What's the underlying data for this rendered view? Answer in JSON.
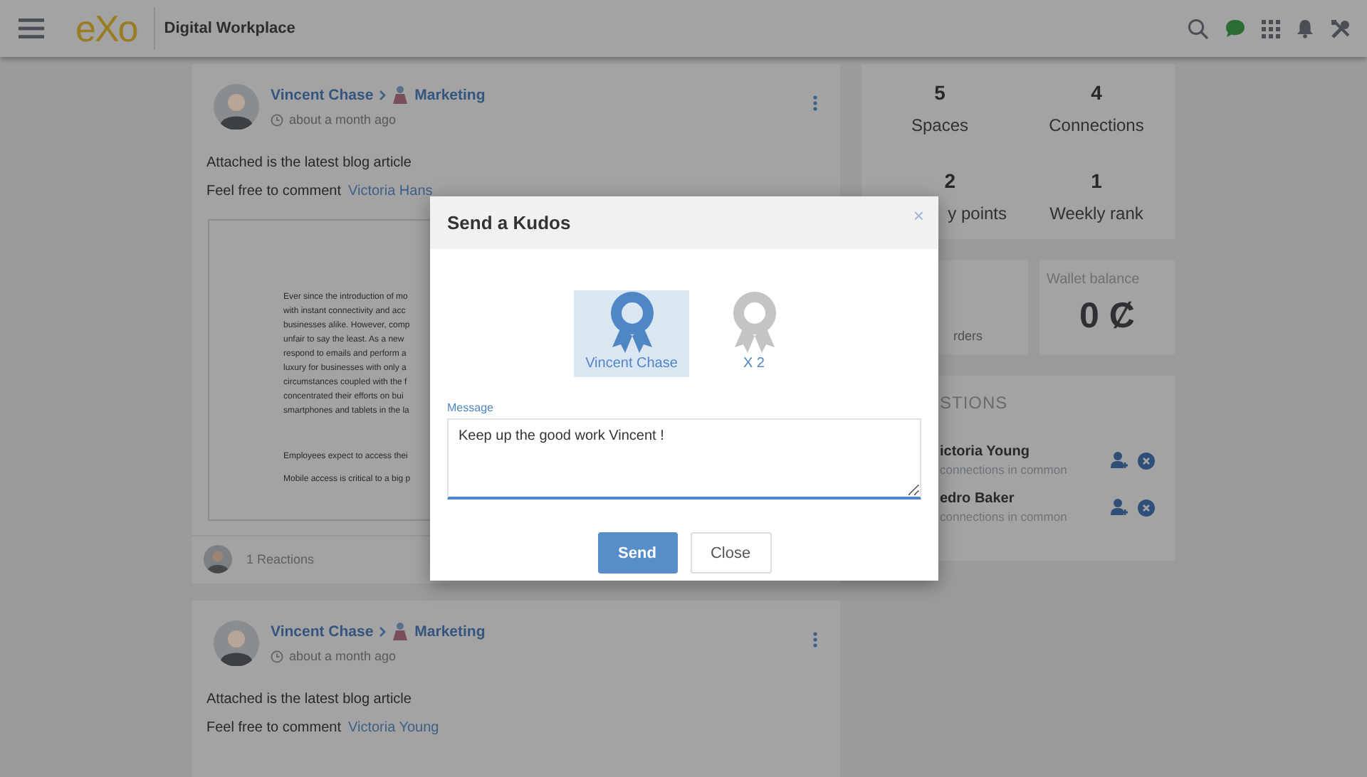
{
  "header": {
    "logo": "eXo",
    "title": "Digital Workplace"
  },
  "posts": [
    {
      "author": "Vincent Chase",
      "space": "Marketing",
      "time": "about a month ago",
      "text": "Attached is the latest blog article",
      "mention_prefix": "Feel free to comment",
      "mention": "Victoria Hans",
      "attachment": [
        "Ever since the introduction of mo",
        "with instant connectivity and acc",
        "businesses alike. However, comp",
        "unfair to say the least. As a new",
        "respond to emails and perform a",
        "luxury for businesses with only a",
        "circumstances coupled with the f",
        "concentrated their efforts on bui",
        "smartphones and tablets in the la"
      ],
      "attachment_footer": [
        "Employees expect to access thei",
        "Mobile access is critical to a big p"
      ],
      "reactions": "1 Reactions"
    },
    {
      "author": "Vincent Chase",
      "space": "Marketing",
      "time": "about a month ago",
      "text": "Attached is the latest blog article",
      "mention_prefix": "Feel free to comment",
      "mention": "Victoria Young"
    }
  ],
  "stats": [
    {
      "value": "5",
      "label": "Spaces"
    },
    {
      "value": "4",
      "label": "Connections"
    },
    {
      "value": "2",
      "label": "y points"
    },
    {
      "value": "1",
      "label": "Weekly rank"
    }
  ],
  "orders": {
    "label": "rders"
  },
  "wallet": {
    "label": "Wallet balance",
    "amount": "0 Ȼ"
  },
  "suggestions": {
    "title": "STIONS",
    "people": [
      {
        "name": "ictoria Young",
        "sub": "connections in common"
      },
      {
        "name": "edro Baker",
        "sub": "connections in common"
      }
    ]
  },
  "modal": {
    "title": "Send a Kudos",
    "close": "×",
    "options": [
      {
        "label": "Vincent Chase",
        "selected": true
      },
      {
        "label": "X 2",
        "selected": false
      }
    ],
    "message_label": "Message",
    "message": "Keep up the good work Vincent !",
    "buttons": [
      {
        "label": "Send",
        "kind": "primary"
      },
      {
        "label": "Close",
        "kind": "secondary"
      }
    ]
  }
}
